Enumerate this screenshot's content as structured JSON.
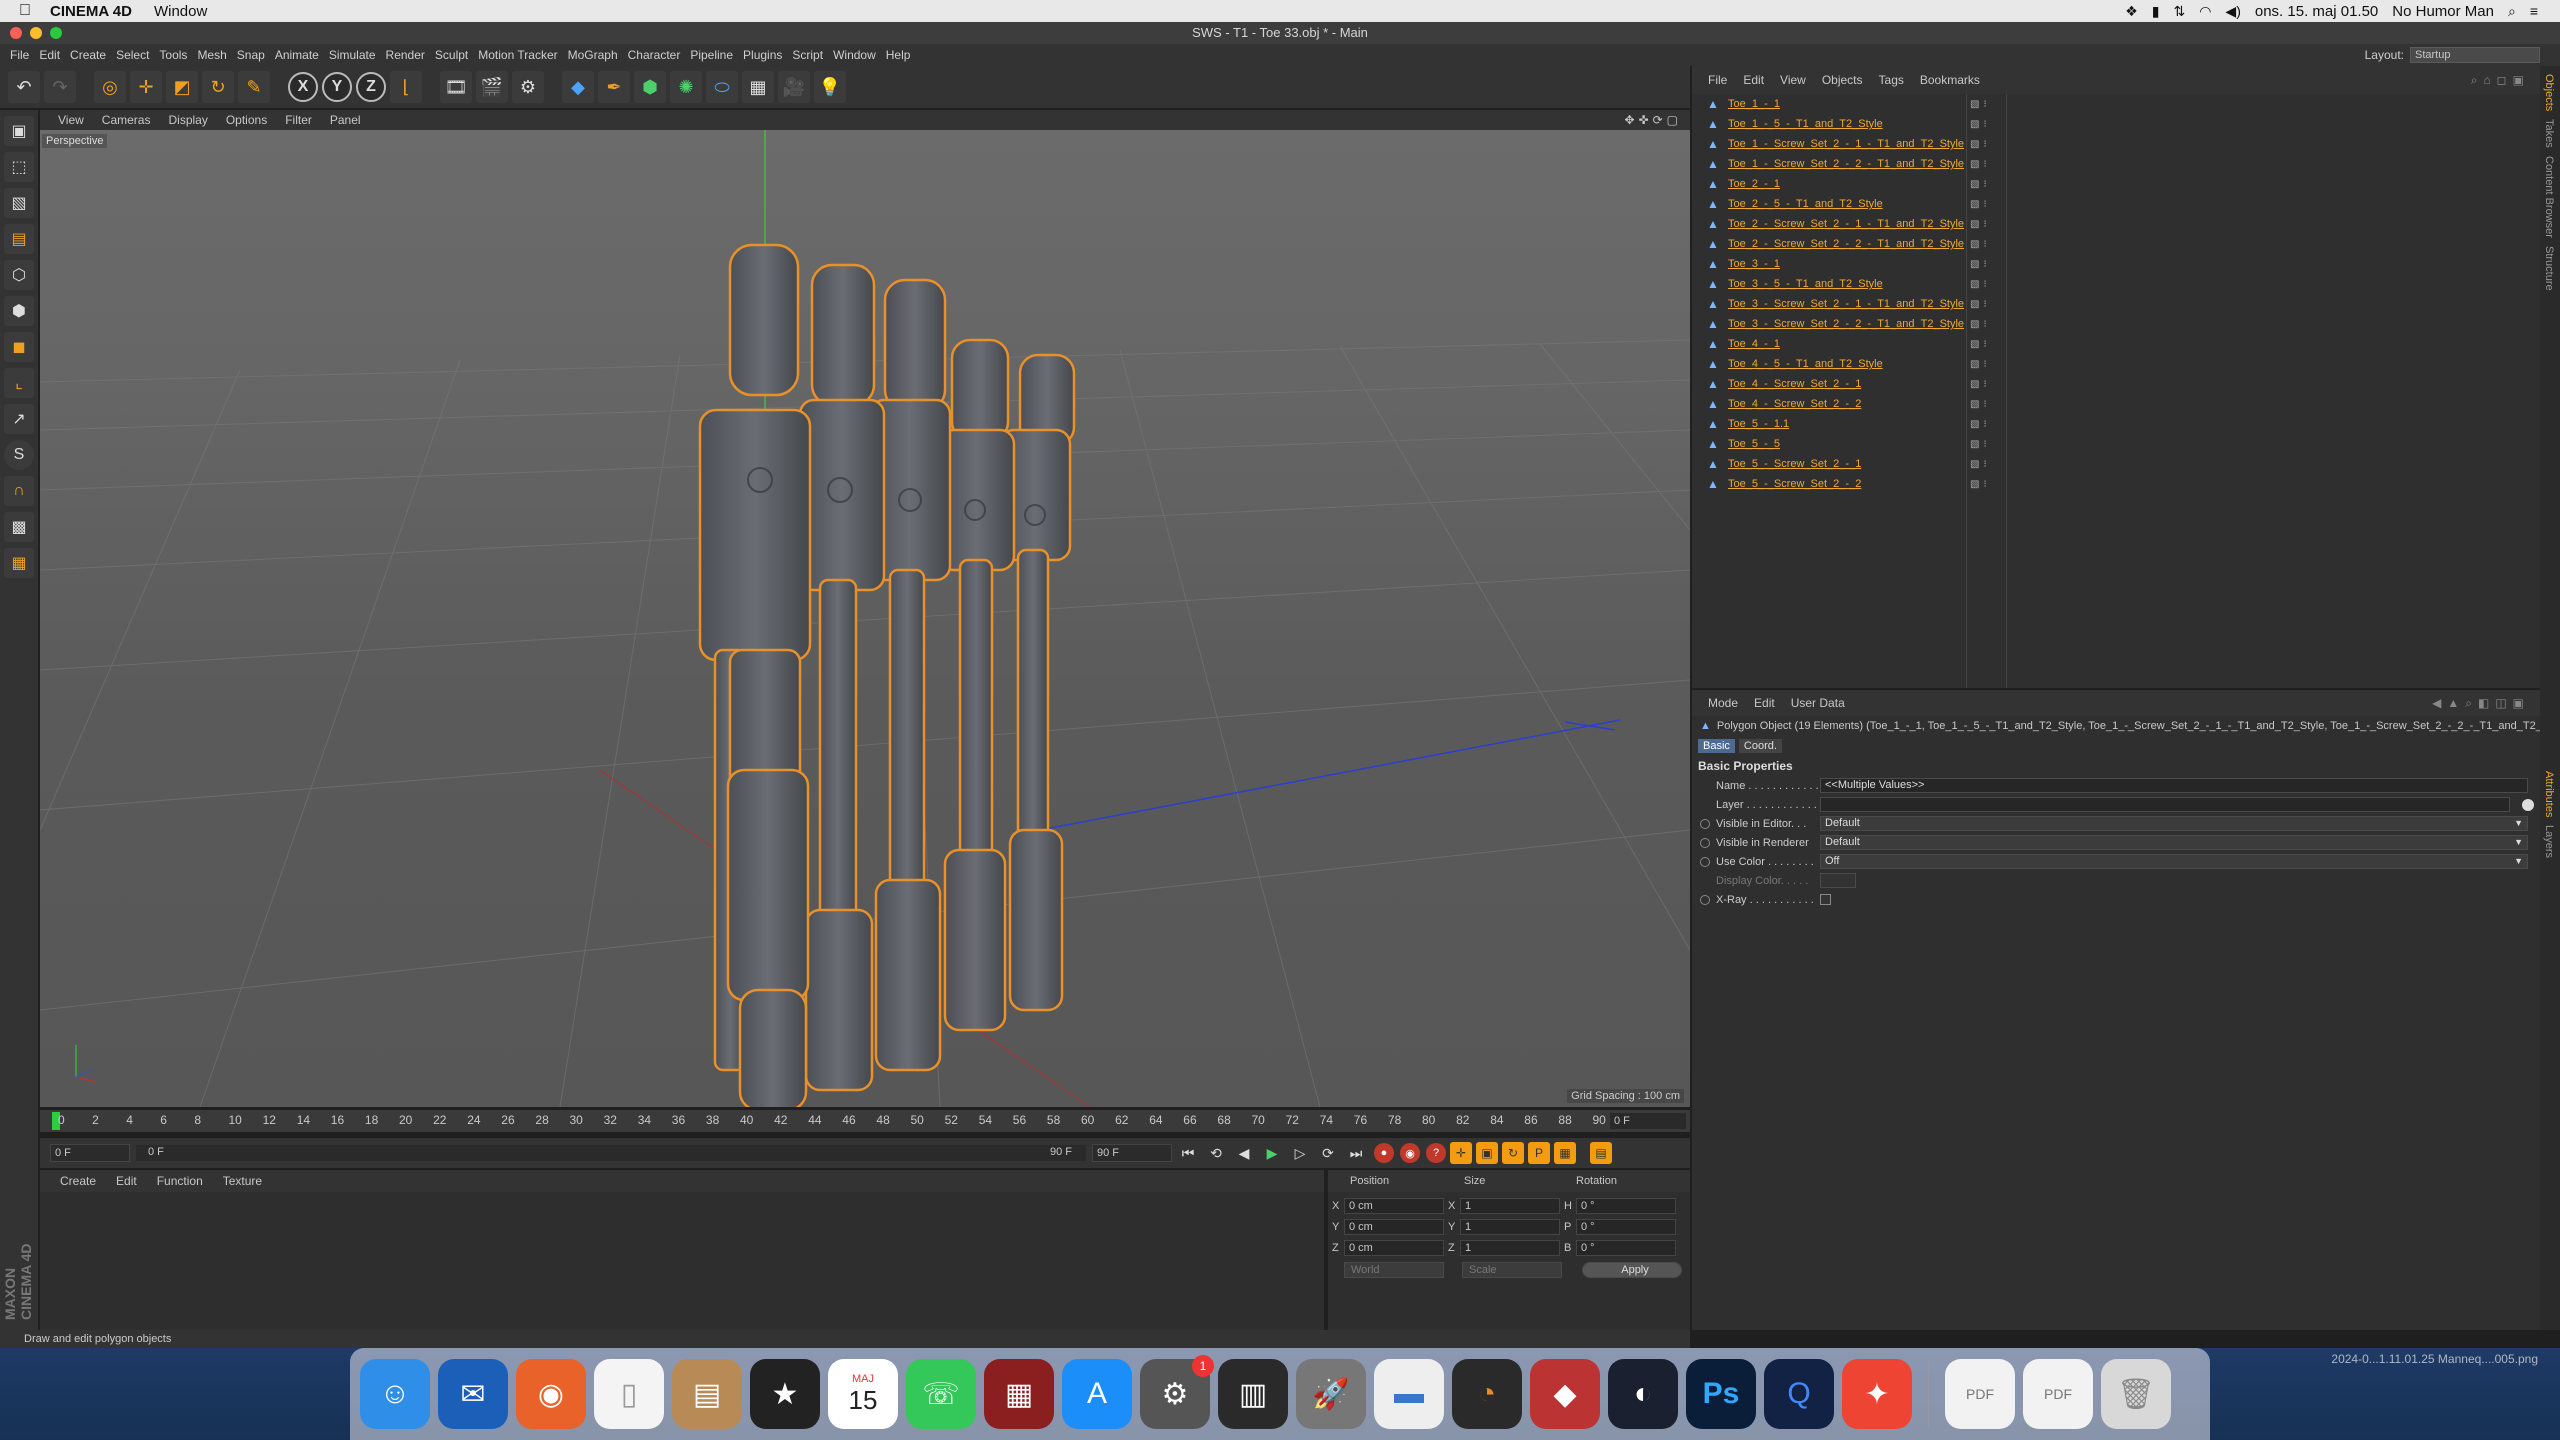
{
  "macbar": {
    "app_name": "CINEMA 4D",
    "menu": [
      "Window"
    ],
    "clock": "ons. 15. maj  01.50",
    "user": "No Humor Man"
  },
  "window": {
    "title": "SWS - T1 - Toe 33.obj * - Main"
  },
  "c4d_menu": {
    "items": [
      "File",
      "Edit",
      "Create",
      "Select",
      "Tools",
      "Mesh",
      "Snap",
      "Animate",
      "Simulate",
      "Render",
      "Sculpt",
      "Motion Tracker",
      "MoGraph",
      "Character",
      "Pipeline",
      "Plugins",
      "Script",
      "Window",
      "Help"
    ],
    "layout_label": "Layout:",
    "layout_value": "Startup"
  },
  "viewport": {
    "menu": [
      "View",
      "Cameras",
      "Display",
      "Options",
      "Filter",
      "Panel"
    ],
    "label": "Perspective",
    "grid_spacing": "Grid Spacing : 100 cm"
  },
  "timeline": {
    "ticks": [
      "0",
      "2",
      "4",
      "6",
      "8",
      "10",
      "12",
      "14",
      "16",
      "18",
      "20",
      "22",
      "24",
      "26",
      "28",
      "30",
      "32",
      "34",
      "36",
      "38",
      "40",
      "42",
      "44",
      "46",
      "48",
      "50",
      "52",
      "54",
      "56",
      "58",
      "60",
      "62",
      "64",
      "66",
      "68",
      "70",
      "72",
      "74",
      "76",
      "78",
      "80",
      "82",
      "84",
      "86",
      "88",
      "90"
    ],
    "current_frame": "0 F",
    "start_field": "0 F",
    "range_start": "0 F",
    "range_end": "90 F",
    "end_field": "90 F"
  },
  "material_manager": {
    "menu": [
      "Create",
      "Edit",
      "Function",
      "Texture"
    ]
  },
  "coord_manager": {
    "headers": [
      "Position",
      "Size",
      "Rotation"
    ],
    "rows": [
      {
        "axis": "X",
        "pos": "0 cm",
        "size_axis": "X",
        "size": "1",
        "rot_axis": "H",
        "rot": "0 °"
      },
      {
        "axis": "Y",
        "pos": "0 cm",
        "size_axis": "Y",
        "size": "1",
        "rot_axis": "P",
        "rot": "0 °"
      },
      {
        "axis": "Z",
        "pos": "0 cm",
        "size_axis": "Z",
        "size": "1",
        "rot_axis": "B",
        "rot": "0 °"
      }
    ],
    "space": "World",
    "mode": "Scale",
    "apply": "Apply"
  },
  "status": "Draw and edit polygon objects",
  "object_manager": {
    "menu": [
      "File",
      "Edit",
      "View",
      "Objects",
      "Tags",
      "Bookmarks"
    ],
    "objects": [
      "Toe_1_-_1",
      "Toe_1_-_5_-_T1_and_T2_Style",
      "Toe_1_-_Screw_Set_2_-_1_-_T1_and_T2_Style",
      "Toe_1_-_Screw_Set_2_-_2_-_T1_and_T2_Style",
      "Toe_2_-_1",
      "Toe_2_-_5_-_T1_and_T2_Style",
      "Toe_2_-_Screw_Set_2_-_1_-_T1_and_T2_Style",
      "Toe_2_-_Screw_Set_2_-_2_-_T1_and_T2_Style",
      "Toe_3_-_1",
      "Toe_3_-_5_-_T1_and_T2_Style",
      "Toe_3_-_Screw_Set_2_-_1_-_T1_and_T2_Style",
      "Toe_3_-_Screw_Set_2_-_2_-_T1_and_T2_Style",
      "Toe_4_-_1",
      "Toe_4_-_5_-_T1_and_T2_Style",
      "Toe_4_-_Screw_Set_2_-_1",
      "Toe_4_-_Screw_Set_2_-_2",
      "Toe_5_-_1.1",
      "Toe_5_-_5",
      "Toe_5_-_Screw_Set_2_-_1",
      "Toe_5_-_Screw_Set_2_-_2"
    ]
  },
  "attribute_manager": {
    "menu": [
      "Mode",
      "Edit",
      "User Data"
    ],
    "object_info": "Polygon Object (19 Elements) (Toe_1_-_1, Toe_1_-_5_-_T1_and_T2_Style, Toe_1_-_Screw_Set_2_-_1_-_T1_and_T2_Style, Toe_1_-_Screw_Set_2_-_2_-_T1_and_T2_St",
    "tabs": [
      "Basic",
      "Coord."
    ],
    "section": "Basic Properties",
    "props": [
      {
        "label": "Name . . . . . . . . . . . .",
        "value": "<<Multiple Values>>"
      },
      {
        "label": "Layer . . . . . . . . . . . .",
        "value": ""
      },
      {
        "label": "Visible in Editor. . .",
        "value": "Default"
      },
      {
        "label": "Visible in Renderer",
        "value": "Default"
      },
      {
        "label": "Use Color . . . . . . . .",
        "value": "Off"
      },
      {
        "label": "Display Color. . . . .",
        "value": ""
      },
      {
        "label": "X-Ray . . . . . . . . . . .",
        "value": ""
      }
    ]
  },
  "side_tabs": [
    "Objects",
    "Takes",
    "Content Browser",
    "Structure",
    "Attributes",
    "Layers"
  ],
  "desktop": {
    "stamp": "2024-0...1.11.01.25   Manneq....005.png"
  },
  "dock": {
    "calendar_month": "MAJ",
    "calendar_day": "15",
    "badge": "1"
  },
  "colors": {
    "accent_orange": "#f0a830",
    "selection_outline": "#e8902a",
    "playhead": "#2ecc40"
  }
}
